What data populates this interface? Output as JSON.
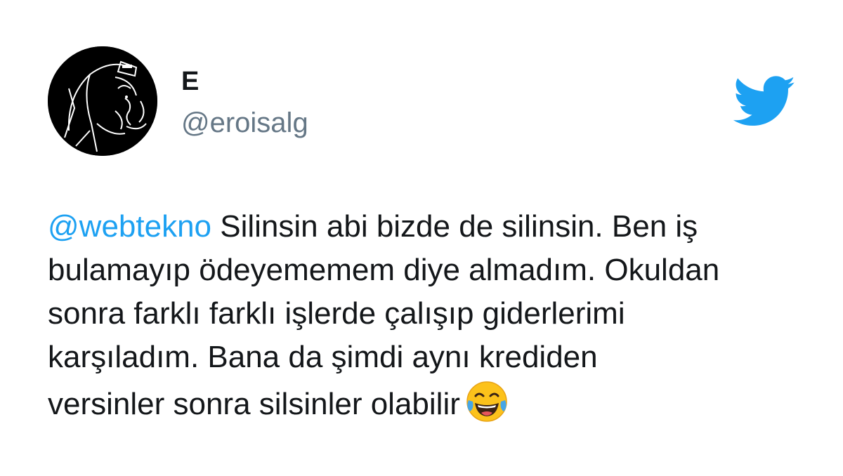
{
  "user": {
    "display_name": "E",
    "handle": "@eroisalg",
    "avatar_icon": "avatar-hooded-figure-icon"
  },
  "brand": {
    "logo_icon": "twitter-bird-icon",
    "color": "#1da1f2"
  },
  "tweet": {
    "mention": "@webtekno",
    "lines": [
      " Silinsin abi bizde de silinsin. Ben iş",
      "bulamayıp ödeyememem diye almadım. Okuldan",
      "sonra farklı farklı işlerde çalışıp giderlerimi",
      "karşıladım. Bana da şimdi aynı krediden",
      "versinler sonra silsinler olabilir"
    ],
    "emoji_icon": "face-with-tears-of-joy-icon"
  },
  "colors": {
    "text": "#14171a",
    "secondary": "#657786",
    "link": "#1da1f2",
    "background": "#ffffff"
  }
}
